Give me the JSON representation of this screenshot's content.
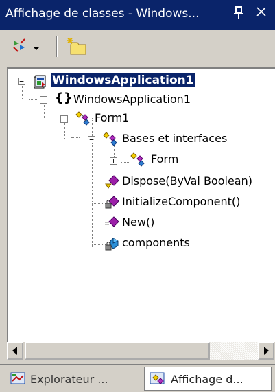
{
  "window": {
    "title": "Affichage de classes - Windows...",
    "pin_glyph": "↕",
    "close_glyph": "×"
  },
  "toolbar": {
    "sort_button_icon": "sort-by-icon",
    "dropdown_icon": "chevron-down-icon",
    "new_folder_icon": "new-folder-icon"
  },
  "tree": {
    "nodes": [
      {
        "label": "WindowsApplication1",
        "icon": "project-icon",
        "expanded": true
      },
      {
        "label": "WindowsApplication1",
        "icon": "namespace-icon",
        "expanded": true
      },
      {
        "label": "Form1",
        "icon": "class-icon",
        "expanded": true
      },
      {
        "label": "Bases et interfaces",
        "icon": "class-icon",
        "expanded": true
      },
      {
        "label": "Form",
        "icon": "class-icon",
        "expanded": false
      },
      {
        "label": "Dispose(ByVal Boolean)",
        "icon": "protected-method-icon"
      },
      {
        "label": "InitializeComponent()",
        "icon": "private-method-icon"
      },
      {
        "label": "New()",
        "icon": "method-icon"
      },
      {
        "label": "components",
        "icon": "private-field-icon"
      }
    ]
  },
  "tabs": [
    {
      "label": "Explorateur ...",
      "icon": "solution-explorer-icon",
      "active": false
    },
    {
      "label": "Affichage d...",
      "icon": "class-view-icon",
      "active": true
    }
  ],
  "colors": {
    "titlebar": "#0a246a",
    "selection": "#0a246a",
    "chrome": "#d4d0c8",
    "method_purple": "#9b1fa8",
    "class_yellow": "#f3d000"
  }
}
